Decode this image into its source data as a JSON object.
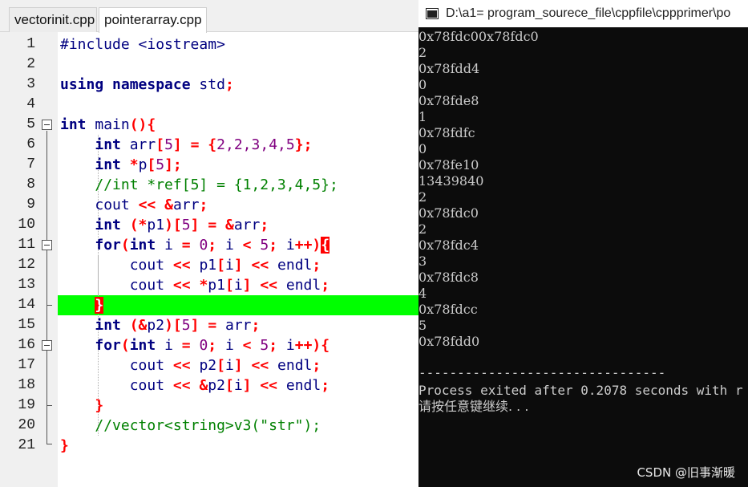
{
  "editor": {
    "tabs": [
      {
        "label": "vectorinit.cpp"
      },
      {
        "label": "pointerarray.cpp"
      }
    ],
    "line_numbers": [
      "1",
      "2",
      "3",
      "4",
      "5",
      "6",
      "7",
      "8",
      "9",
      "10",
      "11",
      "12",
      "13",
      "14",
      "15",
      "16",
      "17",
      "18",
      "19",
      "20",
      "21"
    ],
    "highlighted_line": 14,
    "code": {
      "l1": {
        "pp": "#include <iostream>"
      },
      "l3": {
        "kw1": "using",
        "kw2": "namespace",
        "id": "std",
        "sym": ";"
      },
      "l5": {
        "typ": "int",
        "id": "main",
        "sym1": "()",
        "sym2": "{"
      },
      "l6": {
        "typ": "int",
        "id": "arr",
        "sym1": "[",
        "num1": "5",
        "sym2": "]",
        "sym3": "=",
        "sym4": "{",
        "num2": "2",
        "c1": ",",
        "num3": "2",
        "c2": ",",
        "num4": "3",
        "c3": ",",
        "num5": "4",
        "c4": ",",
        "num6": "5",
        "sym5": "};"
      },
      "l7": {
        "typ": "int",
        "sym1": "*",
        "id": "p",
        "sym2": "[",
        "num": "5",
        "sym3": "];"
      },
      "l8": {
        "cm": "//int *ref[5] = {1,2,3,4,5};"
      },
      "l9": {
        "id1": "cout",
        "sym1": "<<",
        "sym2": "&",
        "id2": "arr",
        "sym3": ";"
      },
      "l10": {
        "typ": "int",
        "sym1": "(*",
        "id1": "p1",
        "sym2": ")[",
        "num": "5",
        "sym3": "]",
        "sym4": "=",
        "sym5": "&",
        "id2": "arr",
        "sym6": ";"
      },
      "l11": {
        "kw": "for",
        "sym1": "(",
        "typ": "int",
        "id1": "i",
        "sym2": "=",
        "num1": "0",
        "sym3": ";",
        "id2": "i",
        "sym4": "<",
        "num2": "5",
        "sym5": ";",
        "id3": "i",
        "sym6": "++)",
        "brk": "{"
      },
      "l12": {
        "id1": "cout",
        "sym1": "<<",
        "id2": "p1",
        "sym2": "[",
        "id3": "i",
        "sym3": "]",
        "sym4": "<<",
        "id4": "endl",
        "sym5": ";"
      },
      "l13": {
        "id1": "cout",
        "sym1": "<<",
        "sym2": "*",
        "id2": "p1",
        "sym3": "[",
        "id3": "i",
        "sym4": "]",
        "sym5": "<<",
        "id4": "endl",
        "sym6": ";"
      },
      "l14": {
        "brk": "}"
      },
      "l15": {
        "typ": "int",
        "sym1": "(&",
        "id1": "p2",
        "sym2": ")[",
        "num": "5",
        "sym3": "]",
        "sym4": "=",
        "id2": "arr",
        "sym5": ";"
      },
      "l16": {
        "kw": "for",
        "sym1": "(",
        "typ": "int",
        "id1": "i",
        "sym2": "=",
        "num1": "0",
        "sym3": ";",
        "id2": "i",
        "sym4": "<",
        "num2": "5",
        "sym5": ";",
        "id3": "i",
        "sym6": "++){"
      },
      "l17": {
        "id1": "cout",
        "sym1": "<<",
        "id2": "p2",
        "sym2": "[",
        "id3": "i",
        "sym3": "]",
        "sym4": "<<",
        "id4": "endl",
        "sym5": ";"
      },
      "l18": {
        "id1": "cout",
        "sym1": "<<",
        "sym2": "&",
        "id2": "p2",
        "sym3": "[",
        "id3": "i",
        "sym4": "]",
        "sym5": "<<",
        "id4": "endl",
        "sym6": ";"
      },
      "l19": {
        "sym": "}"
      },
      "l20": {
        "cm1": "//vector<string>v3(",
        "str": "\"str\"",
        "cm2": ");"
      },
      "l21": {
        "sym": "}"
      }
    }
  },
  "console": {
    "title": "D:\\a1= program_sourece_file\\cppfile\\cppprimer\\po",
    "output_lines": [
      "0x78fdc00x78fdc0",
      "2",
      "0x78fdd4",
      "0",
      "0x78fde8",
      "1",
      "0x78fdfc",
      "0",
      "0x78fe10",
      "13439840",
      "2",
      "0x78fdc0",
      "2",
      "0x78fdc4",
      "3",
      "0x78fdc8",
      "4",
      "0x78fdcc",
      "5",
      "0x78fdd0"
    ],
    "separator": "--------------------------------",
    "process_line": "Process exited after 0.2078 seconds with r",
    "press_key": "请按任意键继续. . ."
  },
  "watermark": "CSDN @旧事渐暖",
  "colors": {
    "highlight_line": "#00ff00",
    "keyword": "#000080",
    "symbol": "#ff0000",
    "number": "#800080",
    "comment": "#008000",
    "console_bg": "#0c0c0c",
    "console_text": "#cccccc"
  }
}
